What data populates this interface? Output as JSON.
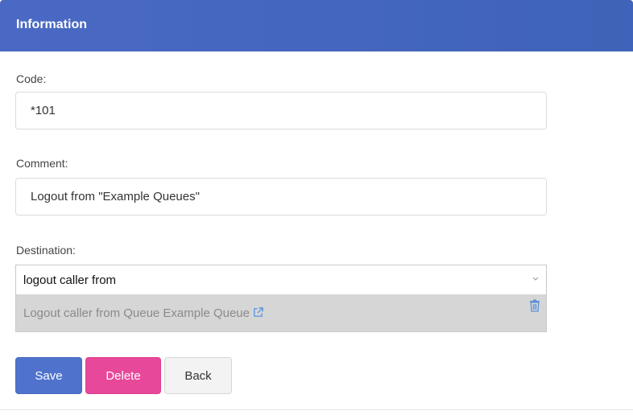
{
  "panel": {
    "title": "Information"
  },
  "form": {
    "code": {
      "label": "Code:",
      "value": "*101"
    },
    "comment": {
      "label": "Comment:",
      "value": "Logout from \"Example Queues\""
    },
    "destination": {
      "label": "Destination:",
      "search_value": "logout caller from",
      "selected_option": "Logout caller from Queue Example Queue",
      "icons": {
        "dropdown": "chevron-down-icon",
        "link": "external-link-icon",
        "remove": "trash-icon"
      }
    }
  },
  "buttons": {
    "save": "Save",
    "delete": "Delete",
    "back": "Back"
  },
  "colors": {
    "header": "#4a69c4",
    "save": "#4f72cc",
    "delete": "#e8489a",
    "link_icon": "#4a90e2",
    "trash_icon": "#5b8fd9"
  }
}
